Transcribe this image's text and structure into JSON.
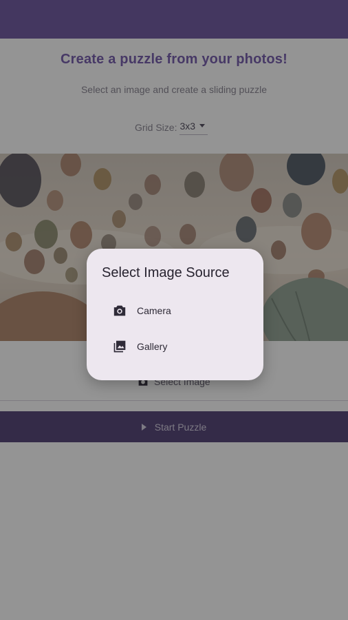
{
  "header": {
    "title": "Create a puzzle from your photos!",
    "subtitle": "Select an image and create a sliding puzzle"
  },
  "grid": {
    "label": "Grid Size:",
    "value": "3x3",
    "icon": "caret-down-icon"
  },
  "image": {
    "description_icon": "image-preview"
  },
  "actions": {
    "select_image_label": "Select Image",
    "select_image_icon": "camera-icon",
    "start_label": "Start Puzzle",
    "start_icon": "play-icon"
  },
  "dialog": {
    "title": "Select Image Source",
    "options": [
      {
        "label": "Camera",
        "icon": "camera-icon"
      },
      {
        "label": "Gallery",
        "icon": "gallery-icon"
      }
    ]
  },
  "colors": {
    "appbar": "#7560a6",
    "accent": "#7b62b0",
    "start_button": "#5a4b7d",
    "dialog_bg": "#ede7ef"
  }
}
